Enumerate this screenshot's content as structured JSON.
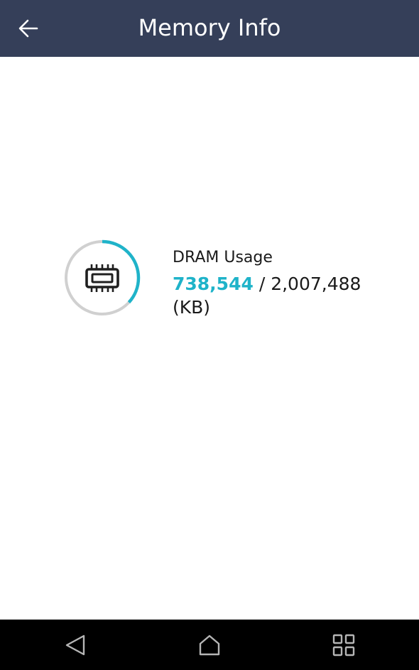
{
  "header": {
    "title": "Memory Info",
    "back_icon": "arrow-left-icon",
    "background": "#353f59"
  },
  "dram": {
    "label": "DRAM Usage",
    "used": "738,544",
    "separator": " / ",
    "total": "2,007,488",
    "unit": "(KB)",
    "used_fraction": 0.368,
    "icon": "memory-chip-icon",
    "accent_color": "#1fb3c9",
    "track_color": "#d0d0d0"
  },
  "nav": {
    "back_icon": "triangle-back-icon",
    "home_icon": "house-home-icon",
    "recents_icon": "grid-recents-icon"
  }
}
